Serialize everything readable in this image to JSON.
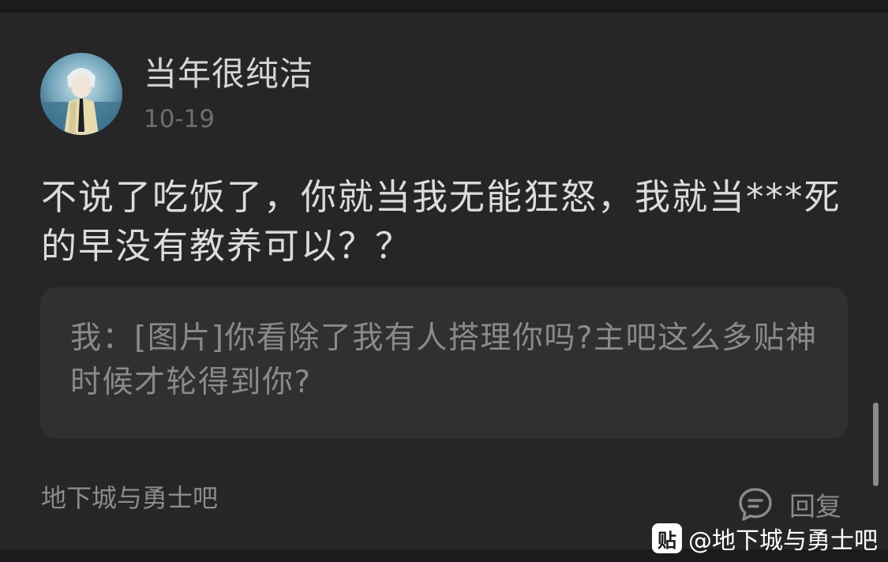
{
  "post": {
    "username": "当年很纯洁",
    "date": "10-19",
    "body": "不说了吃饭了，你就当我无能狂怒，我就当***死的早没有教养可以？？",
    "quote": "我：[图片]你看除了我有人搭理你吗?主吧这么多贴神时候才轮得到你?"
  },
  "footer": {
    "forum_name": "地下城与勇士吧",
    "reply_label": "回复"
  },
  "watermark": {
    "logo_char": "贴",
    "text": "@地下城与勇士吧"
  },
  "icons": {
    "reply": "comment-bubble-icon",
    "avatar": "anime-character-avatar"
  },
  "colors": {
    "background": "#262628",
    "quote_background": "#2f3032",
    "primary_text": "#dcdcdc",
    "secondary_text": "#8a8a8d"
  }
}
